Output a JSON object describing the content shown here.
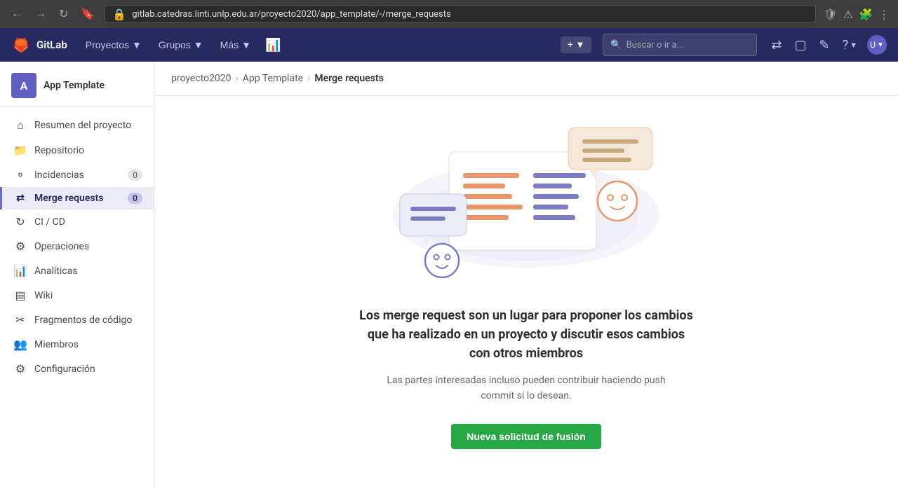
{
  "browser": {
    "url": "gitlab.catedras.linti.unlp.edu.ar/proyecto2020/app_template/-/merge_requests",
    "shield_icon": "🛡",
    "warning_icon": "⚠"
  },
  "navbar": {
    "brand": "GitLab",
    "menu_items": [
      {
        "label": "Proyectos",
        "has_arrow": true
      },
      {
        "label": "Grupos",
        "has_arrow": true
      },
      {
        "label": "Más",
        "has_arrow": true
      }
    ],
    "search_placeholder": "Buscar o ir a...",
    "new_button_title": "Nuevo",
    "merge_request_icon": "⇄",
    "to_do_icon": "✓",
    "edit_icon": "✏",
    "help_label": "?"
  },
  "sidebar": {
    "project_initial": "A",
    "project_name": "App Template",
    "items": [
      {
        "id": "resumen",
        "icon": "🏠",
        "label": "Resumen del proyecto",
        "badge": null,
        "active": false
      },
      {
        "id": "repositorio",
        "icon": "📁",
        "label": "Repositorio",
        "badge": null,
        "active": false
      },
      {
        "id": "incidencias",
        "icon": "🔔",
        "label": "Incidencias",
        "badge": "0",
        "active": false
      },
      {
        "id": "merge-requests",
        "icon": "⇄",
        "label": "Merge requests",
        "badge": "0",
        "active": true
      },
      {
        "id": "ci-cd",
        "icon": "🔄",
        "label": "CI / CD",
        "badge": null,
        "active": false
      },
      {
        "id": "operaciones",
        "icon": "⚙",
        "label": "Operaciones",
        "badge": null,
        "active": false
      },
      {
        "id": "analiticas",
        "icon": "📊",
        "label": "Analíticas",
        "badge": null,
        "active": false
      },
      {
        "id": "wiki",
        "icon": "📖",
        "label": "Wiki",
        "badge": null,
        "active": false
      },
      {
        "id": "fragmentos",
        "icon": "✂",
        "label": "Fragmentos de código",
        "badge": null,
        "active": false
      },
      {
        "id": "miembros",
        "icon": "👥",
        "label": "Miembros",
        "badge": null,
        "active": false
      },
      {
        "id": "configuracion",
        "icon": "⚙",
        "label": "Configuración",
        "badge": null,
        "active": false
      }
    ]
  },
  "breadcrumb": {
    "project": "proyecto2020",
    "repo": "App Template",
    "current": "Merge requests"
  },
  "empty_state": {
    "title": "Los merge request son un lugar para proponer los cambios que ha realizado en un proyecto y discutir esos cambios con otros miembros",
    "description": "Las partes interesadas incluso pueden contribuir haciendo push commit si lo desean.",
    "button_label": "Nueva solicitud de fusión"
  }
}
